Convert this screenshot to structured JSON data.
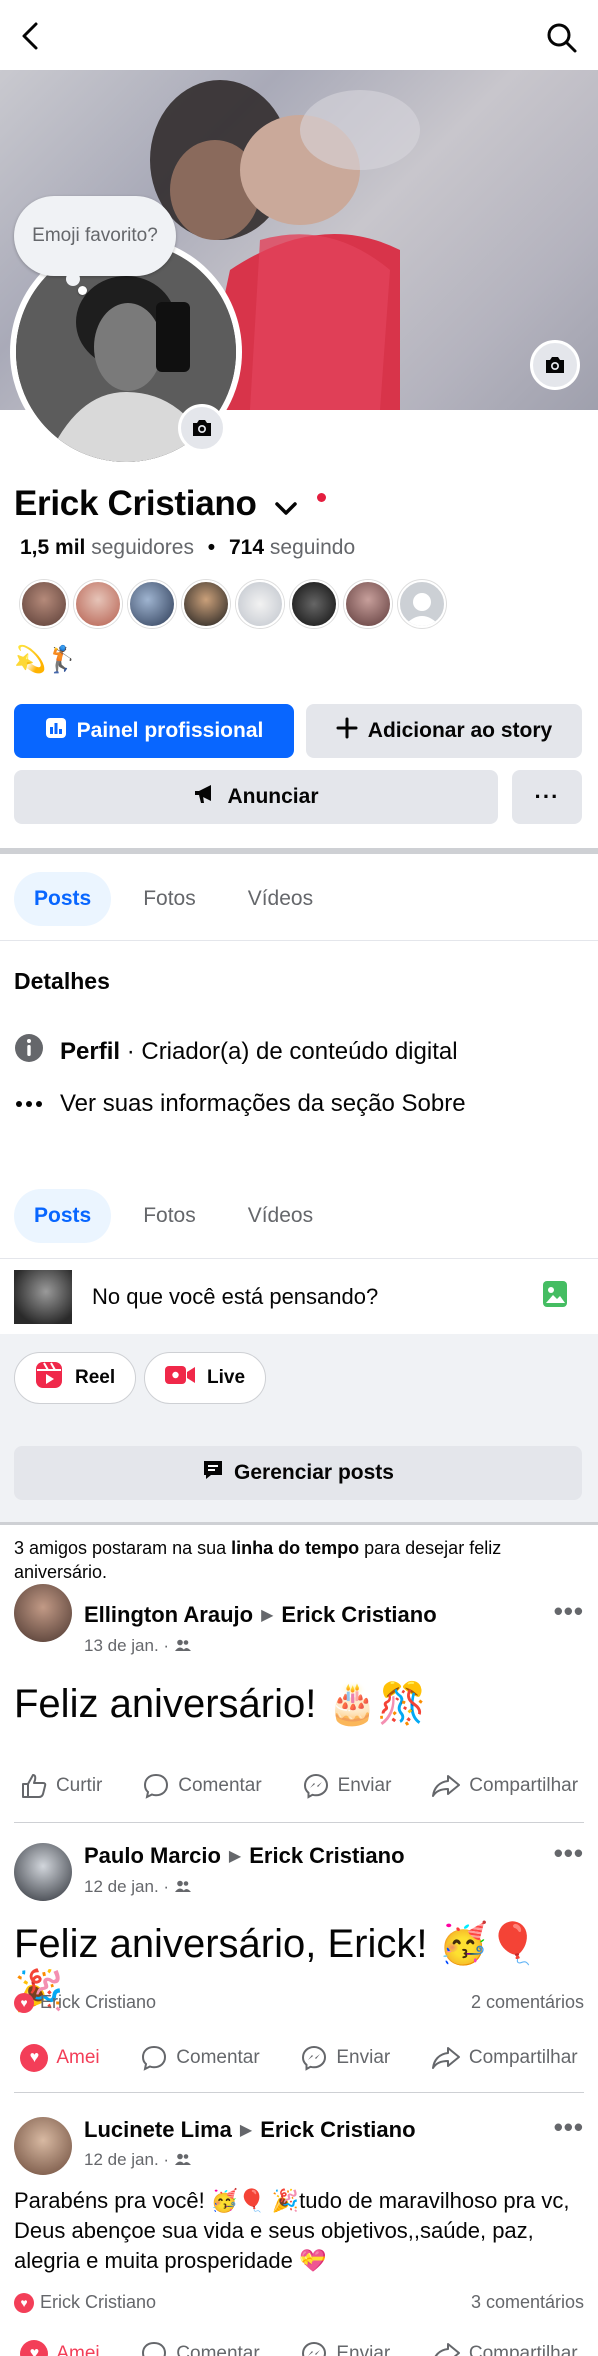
{
  "header": {
    "back_icon": "back-arrow-icon",
    "search_icon": "search-icon"
  },
  "profile": {
    "emoji_bubble": "Emoji favorito?",
    "name": "Erick Cristiano",
    "followers_count": "1,5 mil",
    "followers_label": "seguidores",
    "dot": "•",
    "following_count": "714",
    "following_label": "seguindo",
    "bio": "💫🏌️"
  },
  "buttons": {
    "professional": "Painel profissional",
    "add_story": "Adicionar ao story",
    "advertise": "Anunciar",
    "more": "···"
  },
  "tabs": [
    "Posts",
    "Fotos",
    "Vídeos"
  ],
  "details": {
    "title": "Detalhes",
    "profile_label": "Perfil",
    "profile_value": " · Criador(a) de conteúdo digital",
    "about_link": "Ver suas informações da seção Sobre"
  },
  "composer": {
    "placeholder": "No que você está pensando?"
  },
  "quick_actions": {
    "reel": "Reel",
    "live": "Live"
  },
  "manage_posts": "Gerenciar posts",
  "birthday_notice": {
    "prefix": "3 amigos postaram na sua ",
    "bold": "linha do tempo",
    "suffix": " para desejar feliz aniversário."
  },
  "posts": [
    {
      "author": "Ellington Araujo",
      "target": "Erick Cristiano",
      "date": "13 de jan. ·",
      "text": "Feliz aniversário! 🎂🎊",
      "reaction_by": "",
      "comments": "",
      "liked": false
    },
    {
      "author": "Paulo Marcio",
      "target": "Erick Cristiano",
      "date": "12 de jan. ·",
      "text": "Feliz aniversário, Erick! 🥳🎈 🎉",
      "reaction_by": "Erick Cristiano",
      "comments": "2 comentários",
      "liked": true
    },
    {
      "author": "Lucinete Lima",
      "target": "Erick Cristiano",
      "date": "12 de jan. ·",
      "text": "Parabéns pra você! 🥳🎈 🎉tudo de maravilhoso pra vc, Deus abençoe sua vida e seus objetivos,,saúde, paz, alegria e muita prosperidade 💝",
      "reaction_by": "Erick Cristiano",
      "comments": "3 comentários",
      "liked": true
    }
  ],
  "post_actions": {
    "like": "Curtir",
    "loved": "Amei",
    "comment": "Comentar",
    "send": "Enviar",
    "share": "Compartilhar"
  },
  "colors": {
    "accent": "#0866ff",
    "love": "#f33e58",
    "muted": "#65676b"
  }
}
